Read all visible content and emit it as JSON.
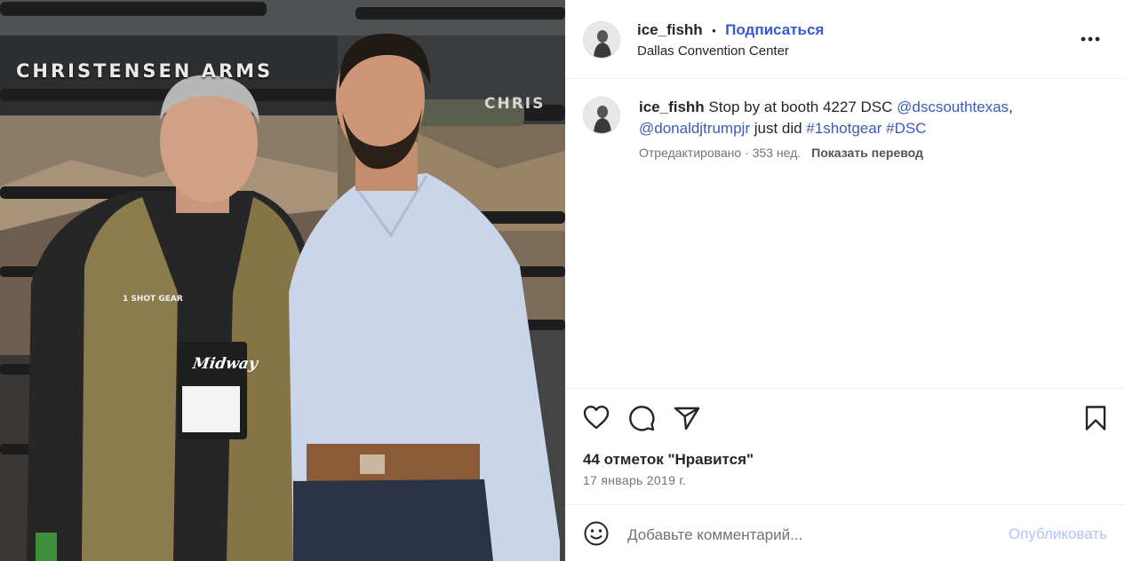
{
  "photo": {
    "brand": "CHRISTENSEN ARMS",
    "brand_partial": "CHRIS",
    "vest_logo": "1 SHOT GEAR",
    "badge_logo": "Midway"
  },
  "header": {
    "username": "ice_fishh",
    "separator": "•",
    "follow_label": "Подписаться",
    "location": "Dallas Convention Center",
    "more_icon": "more-horizontal-icon"
  },
  "caption": {
    "username": "ice_fishh",
    "text_1": " Stop by at booth 4227 DSC ",
    "mention_1": "@dscsouthtexas",
    "text_2": ",",
    "mention_2": "@donaldjtrumpjr",
    "text_3": " just did ",
    "hashtag_1": "#1shotgear",
    "hashtag_2": "#DSC",
    "edited": "Отредактировано · 353 нед.",
    "translate": "Показать перевод"
  },
  "actions": {
    "like_icon": "heart-icon",
    "comment_icon": "comment-icon",
    "share_icon": "share-icon",
    "save_icon": "bookmark-icon"
  },
  "stats": {
    "likes": "44 отметок \"Нравится\"",
    "date": "17 январь 2019 г."
  },
  "comment": {
    "emoji_icon": "emoji-icon",
    "placeholder": "Добавьте комментарий...",
    "publish_label": "Опубликовать"
  },
  "colors": {
    "link": "#3858d6",
    "publish_disabled": "#b2c4f5",
    "secondary_text": "#737373"
  }
}
